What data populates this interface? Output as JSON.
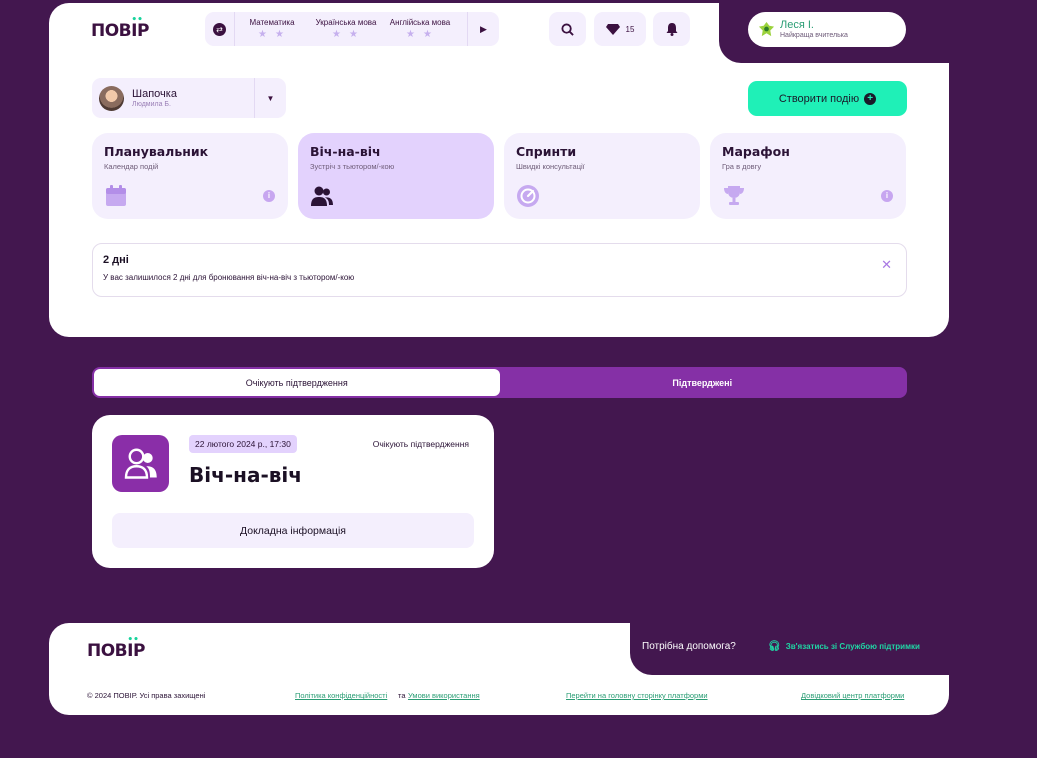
{
  "header": {
    "logo": "ПОВІР",
    "subjects": [
      {
        "name": "Математика",
        "stars": "★★"
      },
      {
        "name": "Українська мова",
        "stars": "★★"
      },
      {
        "name": "Англійська мова",
        "stars": "★★"
      }
    ],
    "gems_count": "15",
    "user": {
      "name": "Леся І.",
      "role": "Найкраща вчителька"
    }
  },
  "teacher": {
    "name": "Шапочка",
    "subtitle": "Людмила Б."
  },
  "create_button": "Створити подію",
  "modes": [
    {
      "title": "Планувальник",
      "subtitle": "Календар подій",
      "icon": "calendar-icon"
    },
    {
      "title": "Віч-на-віч",
      "subtitle": "Зустріч з тьютором/-кою",
      "icon": "users-icon"
    },
    {
      "title": "Спринти",
      "subtitle": "Швидкі консультації",
      "icon": "gauge-icon"
    },
    {
      "title": "Марафон",
      "subtitle": "Гра в довгу",
      "icon": "trophy-icon"
    }
  ],
  "alert": {
    "title": "2 дні",
    "text": "У вас залишилося 2 дні для бронювання віч-на-віч з тьютором/-кою"
  },
  "tabs": {
    "pending": "Очікують підтвердження",
    "confirmed": "Підтверджені"
  },
  "event": {
    "date": "22 лютого 2024 р., 17:30",
    "status": "Очікують підтвердження",
    "title": "Віч-на-віч",
    "details_button": "Докладна інформація"
  },
  "footer": {
    "logo": "ПОВІР",
    "help": "Потрібна допомога?",
    "support_link": "Зв'язатись зі Службою підтримки",
    "copyright": "© 2024 ПОВІР. Усі права захищені",
    "privacy": "Політика конфіденційності",
    "and": "та",
    "terms": "Умови використання",
    "home_link": "Перейти на головну сторінку платформи",
    "help_center": "Довідковий центр платформи"
  },
  "colors": {
    "background": "#43174f",
    "accent": "#1ff0b7",
    "purple": "#8530a6",
    "light": "#f4effd"
  }
}
